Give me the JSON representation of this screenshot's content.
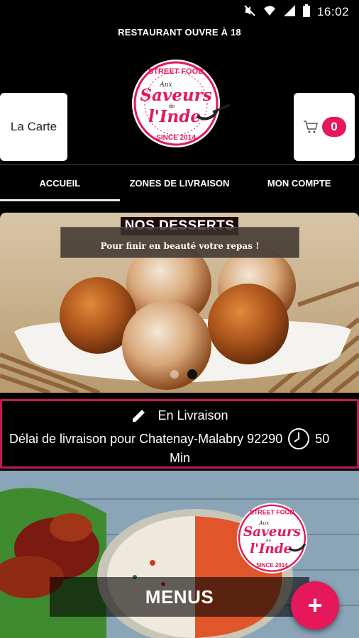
{
  "status_bar": {
    "time": "16:02",
    "icons": [
      "mute-icon",
      "wifi-icon",
      "signal-icon",
      "battery-icon"
    ]
  },
  "announcement": "RESTAURANT OUVRE À 18",
  "header": {
    "carte_label": "La Carte",
    "cart_count": "0",
    "logo": {
      "top": "STREET FOOD",
      "line1": "Aux",
      "line2": "Saveurs",
      "line3": "de",
      "line4": "l'Inde",
      "bottom": "SINCE 2014"
    }
  },
  "nav": [
    {
      "label": "ACCUEIL"
    },
    {
      "label": "ZONES DE LIVRAISON"
    },
    {
      "label": "MON COMPTE"
    }
  ],
  "banner": {
    "title": "NOS DESSERTS",
    "subtitle": "Pour finir en beauté votre repas !",
    "slides": 2,
    "active_slide": 2
  },
  "delivery": {
    "mode": "En Livraison",
    "text": "Délai de livraison pour Chatenay-Malabry 92290",
    "duration": "50",
    "unit": "Min"
  },
  "menus_label": "MENUS",
  "fab_label": "+",
  "colors": {
    "accent": "#e4185a",
    "border": "#c2185b"
  }
}
